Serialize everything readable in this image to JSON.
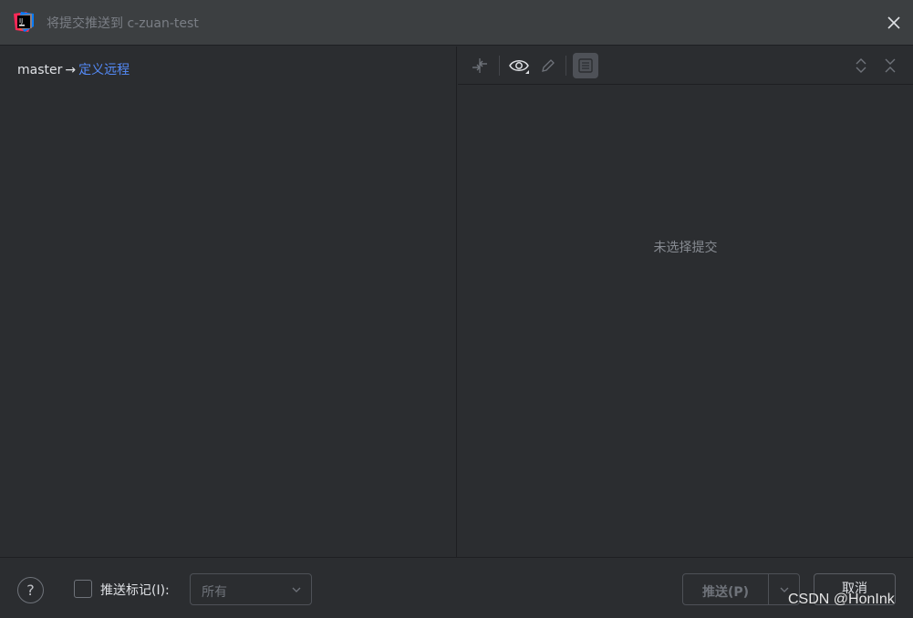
{
  "window": {
    "title": "将提交推送到 c-zuan-test",
    "logo_icon": "intellij-idea-icon",
    "close_icon": "close-icon"
  },
  "left_pane": {
    "branch": "master",
    "arrow": "→",
    "remote_link": "定义远程"
  },
  "toolbar": {
    "icons": [
      "compare-arrows-icon",
      "eye-icon",
      "edit-pencil-icon",
      "details-panel-icon",
      "expand-all-icon",
      "collapse-all-icon"
    ]
  },
  "right_pane": {
    "empty_message": "未选择提交"
  },
  "footer": {
    "help_label": "?",
    "push_tags_label": "推送标记(I):",
    "tags_select_value": "所有",
    "push_button_label": "推送(P)",
    "cancel_button_label": "取消"
  },
  "watermark": "CSDN @HonInk",
  "colors": {
    "background": "#2b2d30",
    "titlebar": "#3c3f41",
    "link": "#548af7",
    "text": "#dfe1e5",
    "muted": "#868a91"
  }
}
